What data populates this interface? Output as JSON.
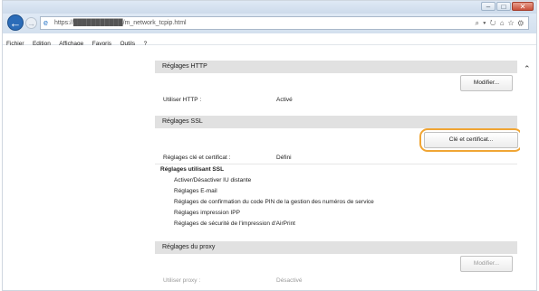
{
  "browser": {
    "url": "https://███████████/m_network_tcpip.html",
    "tools_text": "⌕ ▾ ↻  ⌂ ☆ ⚙",
    "back_glyph": "←",
    "forward_glyph": "→"
  },
  "menu": [
    "Fichier",
    "Edition",
    "Affichage",
    "Favoris",
    "Outils",
    "?"
  ],
  "window_controls": {
    "minimize": "–",
    "maximize": "□",
    "close": "✕"
  },
  "sections": {
    "http": {
      "title": "Réglages HTTP",
      "button": "Modifier...",
      "row_label": "Utiliser HTTP :",
      "row_value": "Activé"
    },
    "ssl": {
      "title": "Réglages SSL",
      "button": "Clé et certificat...",
      "row_label": "Réglages clé et certificat :",
      "row_value": "Défini",
      "subheading": "Réglages utilisant SSL",
      "items": [
        "Activer/Désactiver IU distante",
        "Réglages E-mail",
        "Réglages de confirmation du code PIN de la gestion des numéros de service",
        "Réglages impression IPP",
        "Réglages de sécurité de l'impression d'AirPrint"
      ]
    },
    "proxy": {
      "title": "Réglages du proxy",
      "button": "Modifier...",
      "row_label": "Utiliser proxy :",
      "row_value": "Désactivé"
    }
  },
  "highlight_color": "#f0a534",
  "scroll_up_glyph": "⌃"
}
